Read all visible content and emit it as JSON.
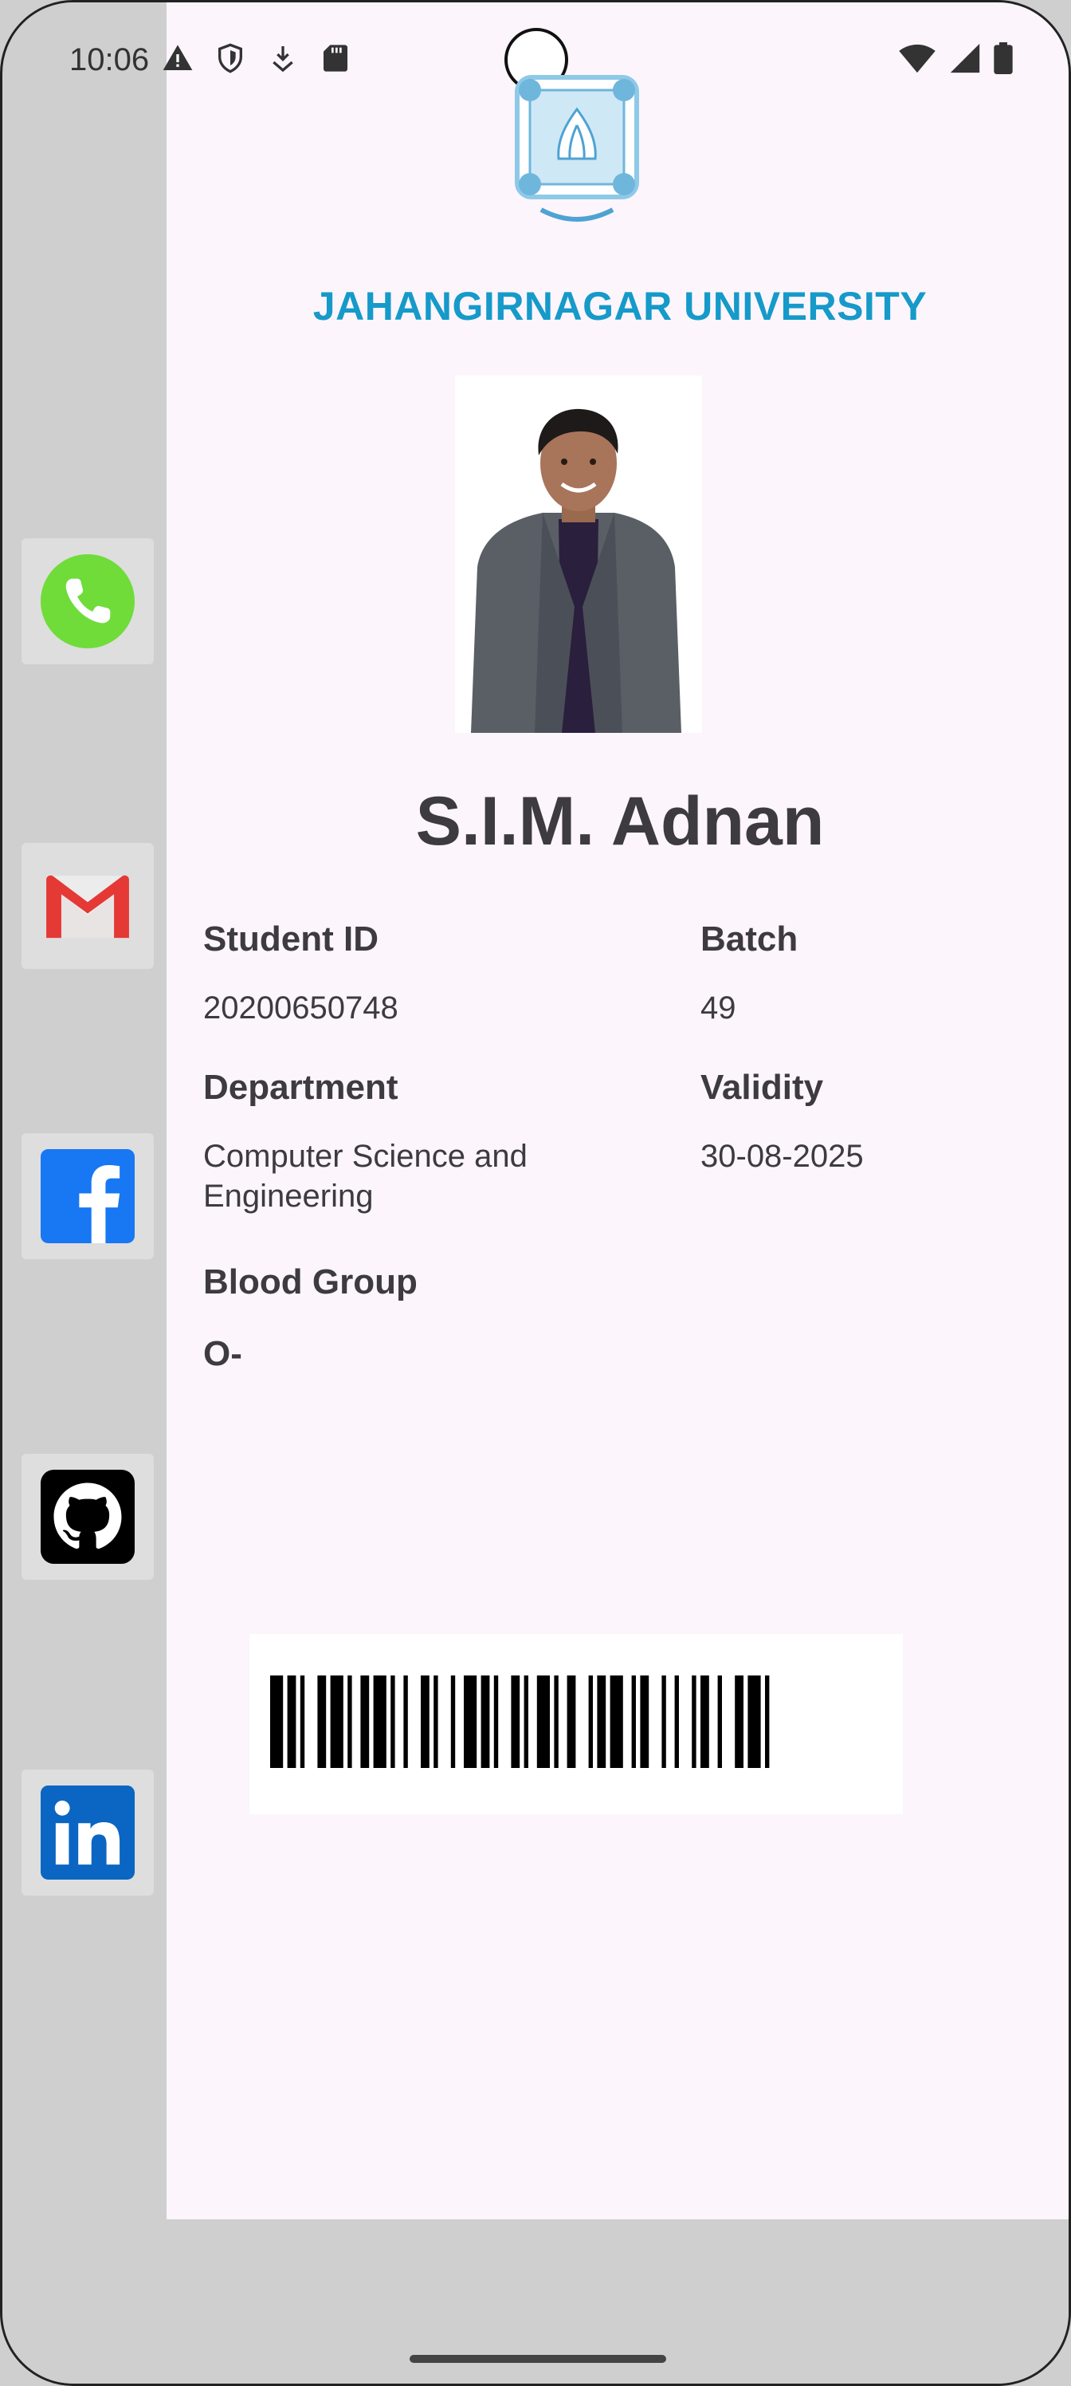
{
  "status_bar": {
    "time": "10:06",
    "left_icons": [
      "warning-icon",
      "shield-icon",
      "download-icon",
      "sd-card-icon"
    ],
    "right_icons": [
      "wifi-icon",
      "signal-icon",
      "battery-icon"
    ]
  },
  "sidebar": {
    "items": [
      {
        "name": "phone",
        "icon": "phone-icon",
        "color": "#6fdc3a"
      },
      {
        "name": "gmail",
        "icon": "gmail-icon",
        "color": "#e53935"
      },
      {
        "name": "facebook",
        "icon": "facebook-icon",
        "color": "#1877f2"
      },
      {
        "name": "github",
        "icon": "github-icon",
        "color": "#000000"
      },
      {
        "name": "linkedin",
        "icon": "linkedin-icon",
        "color": "#0a66c2"
      }
    ]
  },
  "card": {
    "university": "JAHANGIRNAGAR UNIVERSITY",
    "logo_icon": "university-logo-icon",
    "name": "S.I.M. Adnan",
    "fields": {
      "student_id_label": "Student ID",
      "student_id_value": "20200650748",
      "batch_label": "Batch",
      "batch_value": "49",
      "department_label": "Department",
      "department_value_line1": "Computer Science and",
      "department_value_line2": "Engineering",
      "validity_label": "Validity",
      "validity_value": "30-08-2025",
      "blood_group_label": "Blood Group",
      "blood_group_value": "O-"
    },
    "barcode_icon": "barcode-icon"
  },
  "colors": {
    "accent": "#159ac9",
    "text": "#3d3a40",
    "background": "#fcf5fc"
  }
}
